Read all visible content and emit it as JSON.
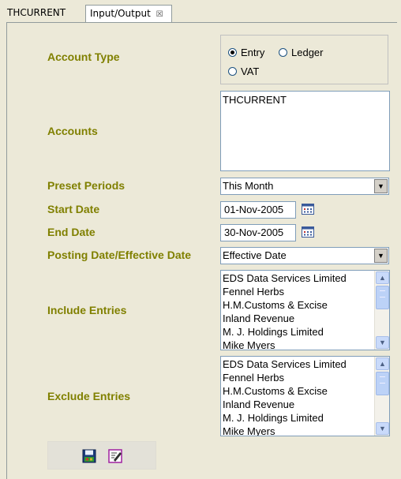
{
  "tabs": [
    {
      "label": "THCURRENT"
    },
    {
      "label": "Input/Output",
      "close": "☒"
    }
  ],
  "form": {
    "account_type": {
      "label": "Account Type",
      "options": [
        "Entry",
        "Ledger",
        "VAT"
      ],
      "selected": "Entry"
    },
    "accounts": {
      "label": "Accounts",
      "items": [
        "THCURRENT"
      ]
    },
    "preset_periods": {
      "label": "Preset Periods",
      "value": "This Month"
    },
    "start_date": {
      "label": "Start Date",
      "value": "01-Nov-2005"
    },
    "end_date": {
      "label": "End Date",
      "value": "30-Nov-2005"
    },
    "posting_date": {
      "label": "Posting Date/Effective Date",
      "value": "Effective Date"
    },
    "include_entries": {
      "label": "Include Entries",
      "items": [
        "EDS Data Services Limited",
        "Fennel Herbs",
        "H.M.Customs & Excise",
        "Inland Revenue",
        "M. J. Holdings Limited",
        "Mike Myers"
      ]
    },
    "exclude_entries": {
      "label": "Exclude Entries",
      "items": [
        "EDS Data Services Limited",
        "Fennel Herbs",
        "H.M.Customs & Excise",
        "Inland Revenue",
        "M. J. Holdings Limited",
        "Mike Myers"
      ]
    }
  },
  "toolbar": {
    "icons": [
      "save-icon",
      "edit-icon"
    ]
  },
  "colors": {
    "label": "#808000",
    "background": "#ece9d8",
    "field_border": "#7f9db9"
  }
}
